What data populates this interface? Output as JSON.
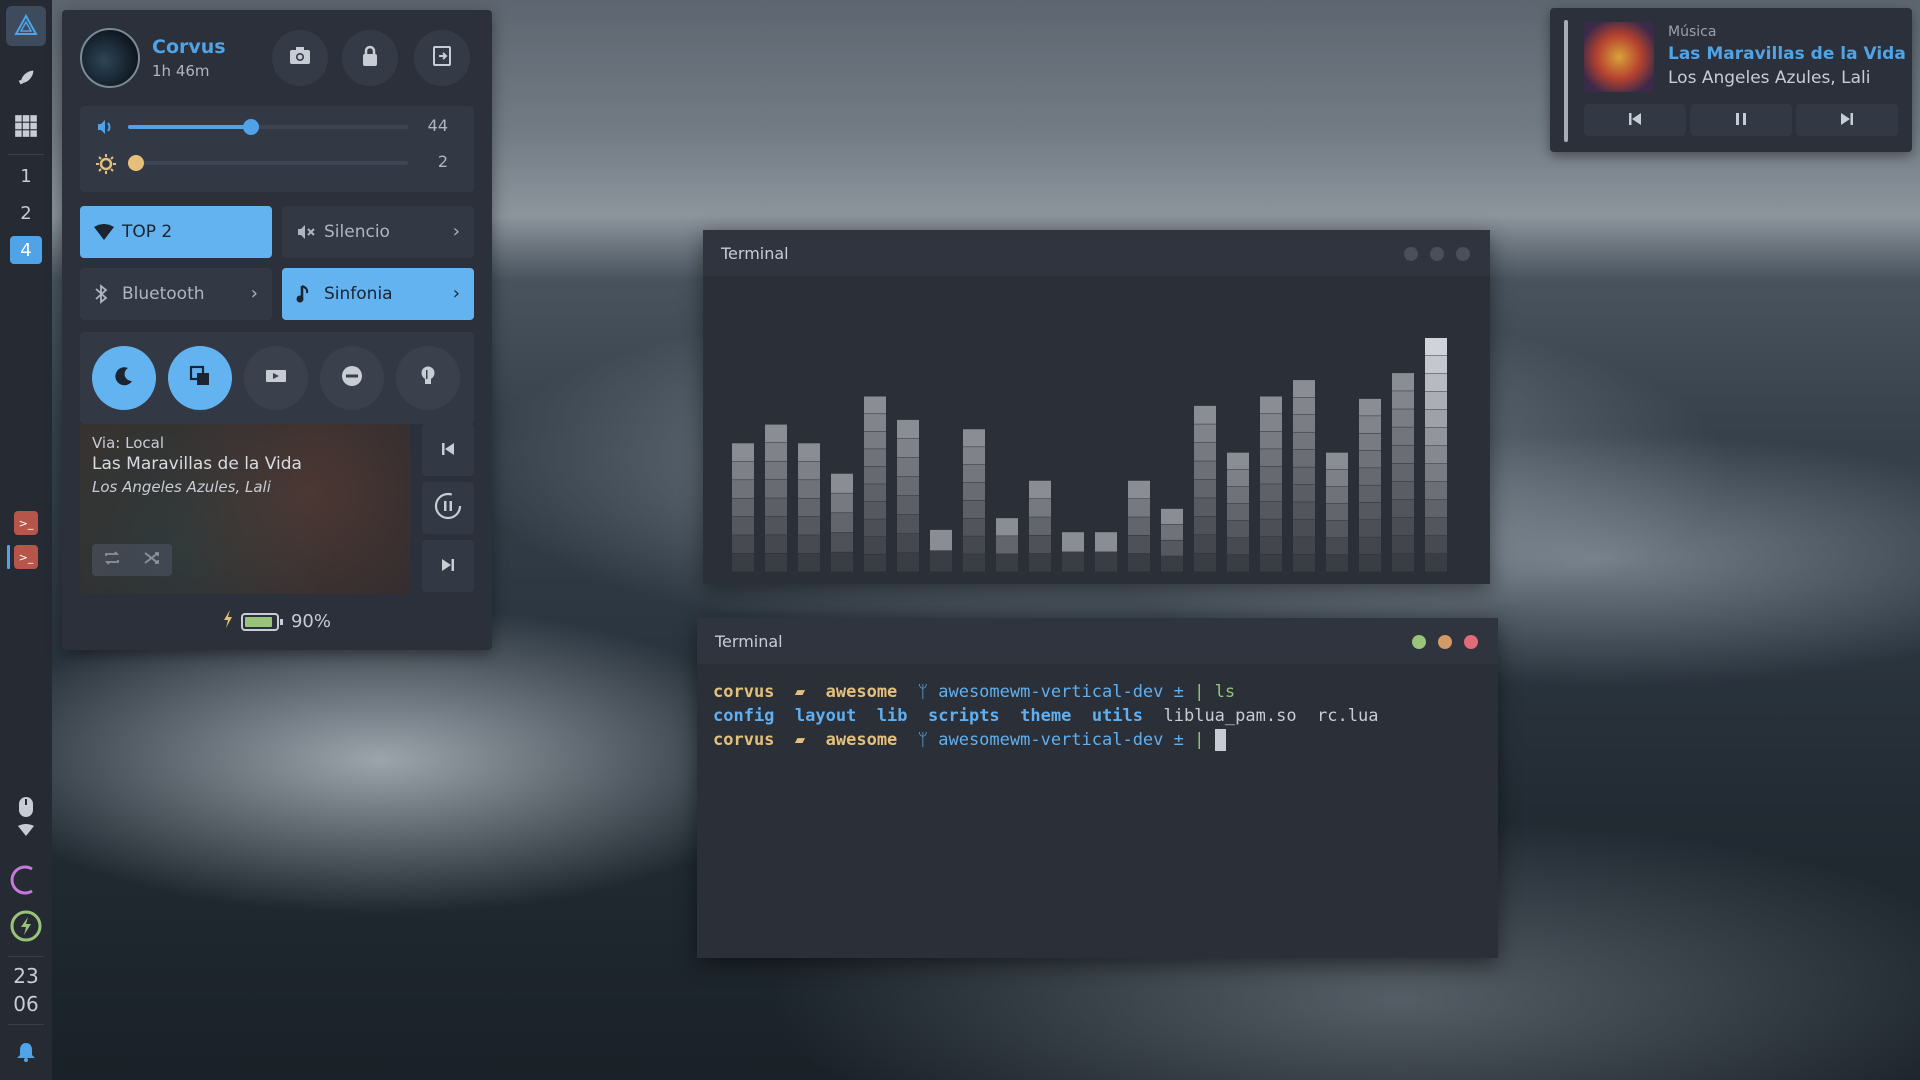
{
  "leftbar": {
    "tags": [
      "1",
      "2",
      "4"
    ],
    "active_tag": "4",
    "clock": {
      "hour": "23",
      "minute": "06"
    }
  },
  "control_center": {
    "user_name": "Corvus",
    "uptime": "1h 46m",
    "volume": {
      "value_label": "44",
      "level_percent": 44
    },
    "brightness": {
      "value_label": "2",
      "level_percent": 2
    },
    "quick_toggles": {
      "wifi_label": "TOP 2",
      "dnd_label": "Silencio",
      "bluetooth_label": "Bluetooth",
      "music_label": "Sinfonia"
    },
    "media": {
      "source": "Via: Local",
      "title": "Las Maravillas de la Vida",
      "artist": "Los Angeles Azules, Lali"
    },
    "battery_label": "90%",
    "battery_percent": 90
  },
  "music_notification": {
    "app": "Música",
    "title": "Las Maravillas de la Vida",
    "artist": "Los Angeles Azules, Lali"
  },
  "terminal_top": {
    "title": "Terminal",
    "visualizer_levels": [
      0.55,
      0.63,
      0.55,
      0.42,
      0.75,
      0.65,
      0.18,
      0.61,
      0.23,
      0.39,
      0.17,
      0.17,
      0.39,
      0.27,
      0.71,
      0.51,
      0.75,
      0.82,
      0.51,
      0.74,
      0.85,
      1.0
    ]
  },
  "terminal_bottom": {
    "title": "Terminal",
    "prompt_user": "corvus",
    "prompt_dir": "awesome",
    "prompt_branch": "awesomewm-vertical-dev ±",
    "command": "ls",
    "ls_dirs": [
      "config",
      "layout",
      "lib",
      "scripts",
      "theme",
      "utils"
    ],
    "ls_files": [
      "liblua_pam.so",
      "rc.lua"
    ]
  },
  "colors": {
    "accent": "#4fa3e6",
    "accent_light": "#63b3f0",
    "panel_bg": "#2b303a",
    "dot_green": "#98c379",
    "dot_orange": "#d19a66",
    "dot_red": "#e06c75"
  }
}
